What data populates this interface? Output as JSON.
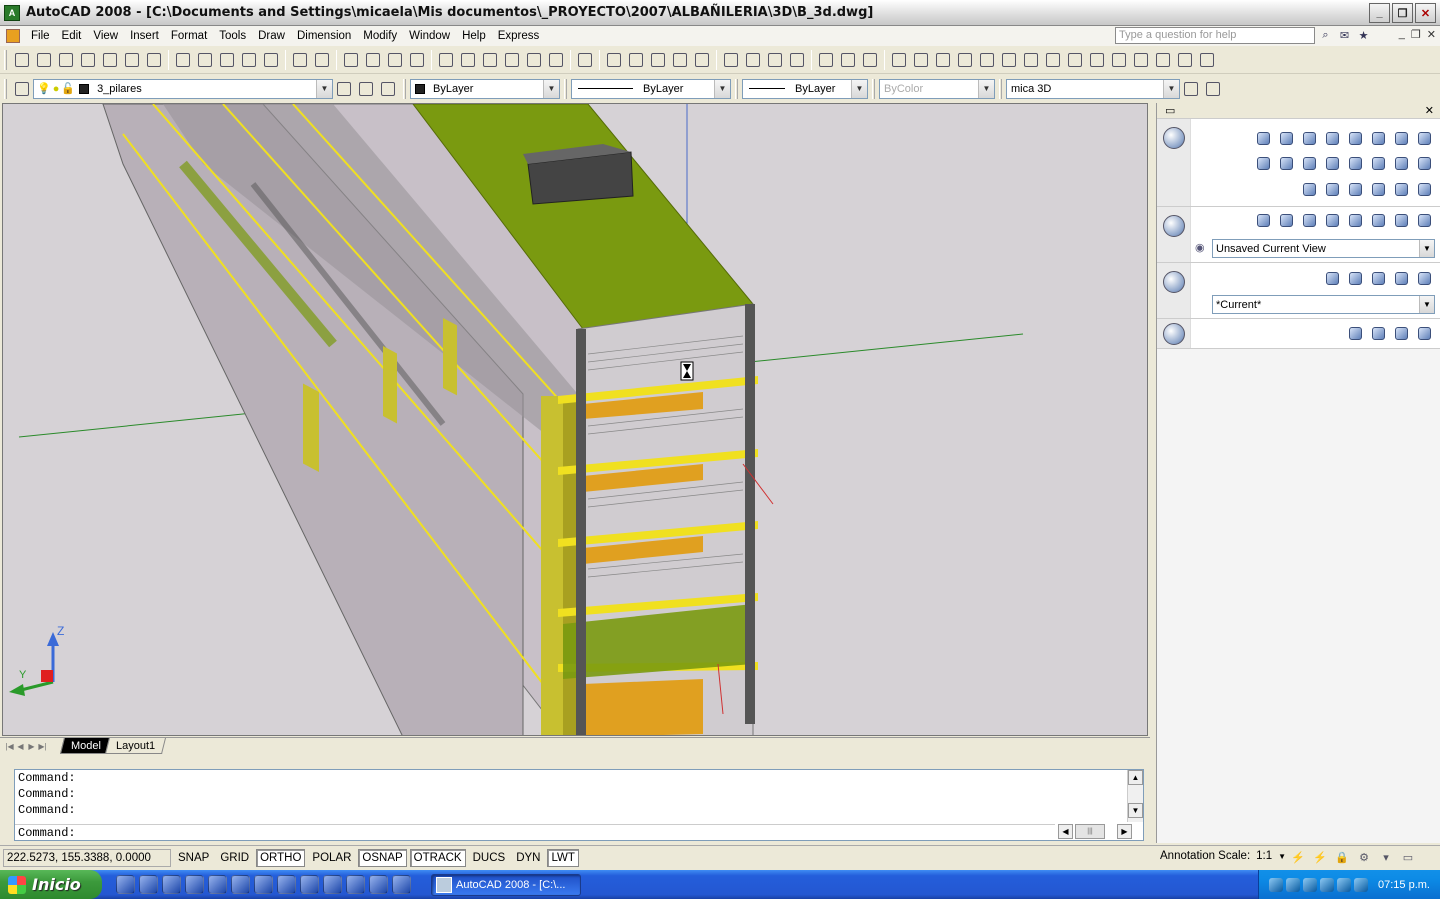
{
  "window": {
    "title": "AutoCAD 2008 - [C:\\Documents and Settings\\micaela\\Mis documentos\\_PROYECTO\\2007\\ALBAÑILERIA\\3D\\B_3d.dwg]",
    "app_icon": "autocad-icon",
    "buttons": [
      "minimize",
      "restore",
      "close"
    ]
  },
  "menubar": {
    "items": [
      "File",
      "Edit",
      "View",
      "Insert",
      "Format",
      "Tools",
      "Draw",
      "Dimension",
      "Modify",
      "Window",
      "Help",
      "Express"
    ],
    "help_placeholder": "Type a question for help"
  },
  "toolbar_layers": {
    "current_layer": "3_pilares",
    "color": "ByLayer",
    "linetype": "ByLayer",
    "lineweight": "ByLayer",
    "plotstyle": "ByColor",
    "visual_style": "mica 3D"
  },
  "tabs": {
    "items": [
      "Model",
      "Layout1"
    ],
    "active": "Model"
  },
  "command_line": {
    "history": [
      "Command:",
      "Command:",
      "Command:"
    ],
    "current": "Command:"
  },
  "statusbar": {
    "coordinates": "222.5273, 155.3388, 0.0000",
    "toggles": [
      {
        "label": "SNAP",
        "on": false
      },
      {
        "label": "GRID",
        "on": false
      },
      {
        "label": "ORTHO",
        "on": true
      },
      {
        "label": "POLAR",
        "on": false
      },
      {
        "label": "OSNAP",
        "on": true
      },
      {
        "label": "OTRACK",
        "on": true
      },
      {
        "label": "DUCS",
        "on": false
      },
      {
        "label": "DYN",
        "on": false
      },
      {
        "label": "LWT",
        "on": true
      }
    ],
    "annotation_scale_label": "Annotation Scale:",
    "annotation_scale_value": "1:1"
  },
  "dashboard": {
    "view_combo": "Unsaved Current View",
    "visual_combo": "*Current*"
  },
  "ucs_icon": {
    "z_label": "Z",
    "y_label": "Y"
  },
  "taskbar": {
    "start_label": "Inicio",
    "task_item": "AutoCAD 2008 - [C:\\...",
    "clock": "07:15 p.m."
  },
  "colors": {
    "viewport_bg": "#d6d2d6",
    "roof_green": "#7a9a10",
    "slab_yellow": "#f0e020",
    "column_olive": "#c8c030",
    "taskbar_blue": "#245edb"
  }
}
